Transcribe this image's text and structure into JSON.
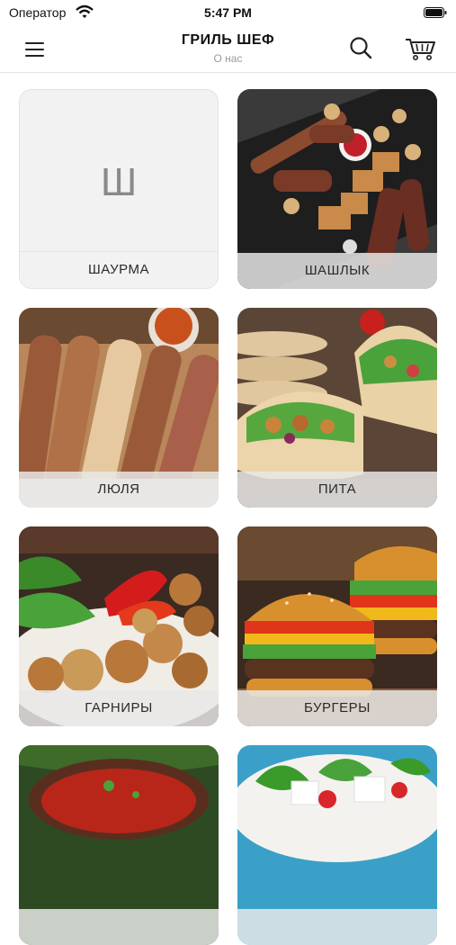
{
  "status_bar": {
    "carrier": "Оператор",
    "time": "5:47 PM"
  },
  "header": {
    "title": "ГРИЛЬ ШЕФ",
    "subtitle": "О нас"
  },
  "icons": {
    "menu": "hamburger-icon",
    "search": "search-icon",
    "cart": "cart-icon"
  },
  "categories": [
    {
      "label": "ШАУРМА",
      "placeholder_letter": "Ш"
    },
    {
      "label": "ШАШЛЫК"
    },
    {
      "label": "ЛЮЛЯ"
    },
    {
      "label": "ПИТА"
    },
    {
      "label": "ГАРНИРЫ"
    },
    {
      "label": "БУРГЕРЫ"
    },
    {
      "label": ""
    },
    {
      "label": ""
    }
  ]
}
